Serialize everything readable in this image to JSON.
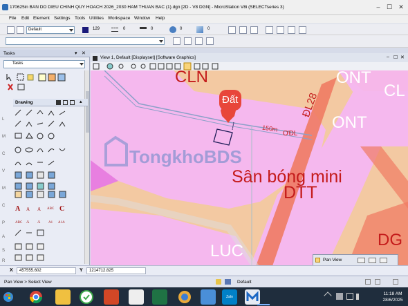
{
  "window": {
    "title": "170625in BAN DO DIEU CHINH QUY HOACH 2026_2030 HAM THUAN BAC (1).dgn [2D - V8 DGN] - MicroStation V8i (SELECTseries 3)",
    "controls": [
      "–",
      "☐",
      "✕"
    ]
  },
  "menu": [
    "File",
    "Edit",
    "Element",
    "Settings",
    "Tools",
    "Utilities",
    "Workspace",
    "Window",
    "Help"
  ],
  "attributes_bar": {
    "level": "Default",
    "color_value": "129",
    "weight": "0",
    "style": "0",
    "transparency": "0",
    "priority": "0"
  },
  "left_panel": {
    "header": "Tasks",
    "tasks_dropdown": "Tasks",
    "drawing_label": "Drawing",
    "section_letters": [
      "L",
      "M",
      "C",
      "V",
      "M",
      "C",
      "P",
      "A",
      "S",
      "R"
    ]
  },
  "view": {
    "title": "View 1, Default [Displayset] [Software Graphics]"
  },
  "map": {
    "labels": {
      "cln": "CLN",
      "ont_top": "ONT",
      "cl_right": "CL",
      "ont_mid": "ONT",
      "dat_marker": "Đất",
      "road_dist": "150m",
      "road_code": "ĐL28",
      "road_tail": "ƠĐL",
      "watermark": "TongkhoBDS",
      "san_bong": "Sân bóng mini",
      "dtt": "DTT",
      "luc": "LUC",
      "dg": "DG"
    },
    "colors": {
      "pink": "#f5b8ee",
      "orange": "#f3c9a2",
      "salmon": "#f07b63",
      "road": "#e0a0e8",
      "marker": "#e8463a",
      "red_text": "#cc1d1d"
    }
  },
  "pan_view": {
    "title": "Pan View"
  },
  "coords": {
    "x_label": "X",
    "x_value": "457555.602",
    "y_label": "Y",
    "y_value": "1214712.825"
  },
  "status": {
    "prompt": "Pan View > Select View",
    "level": "Default"
  },
  "taskbar": {
    "apps": [
      "zalo-app",
      "microstation-app"
    ],
    "zalo_label": "Zalo",
    "time": "11:18 AM",
    "date": "28/6/2025"
  }
}
